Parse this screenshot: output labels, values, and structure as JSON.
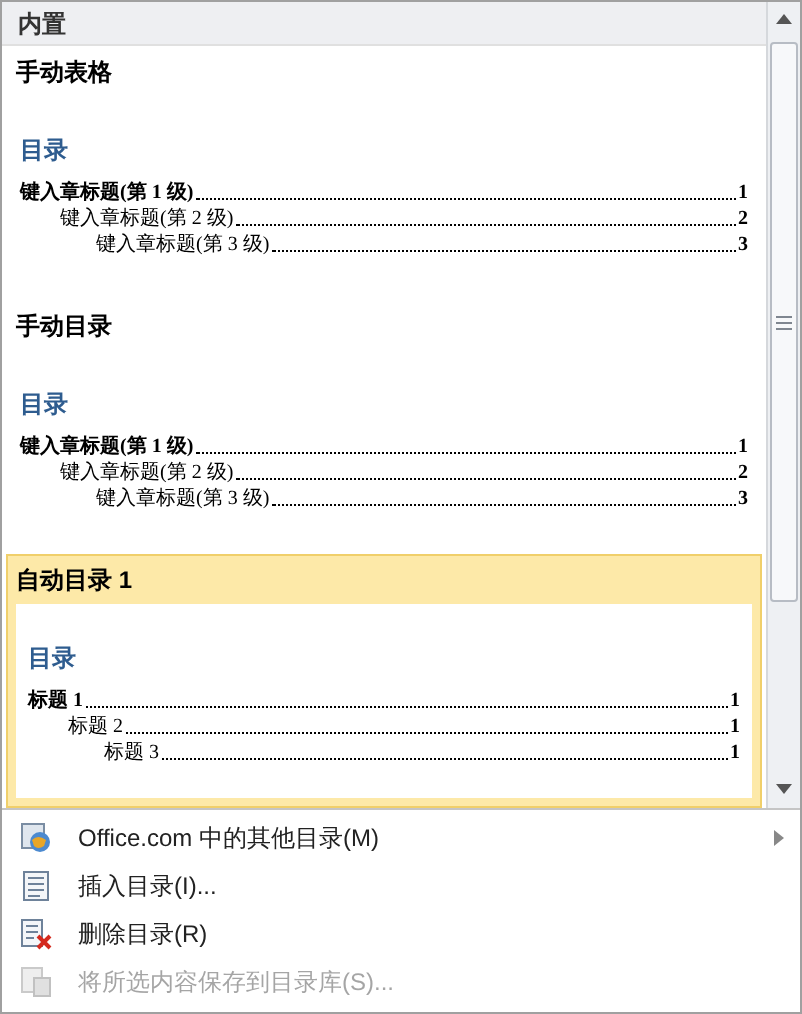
{
  "gallery": {
    "header": "内置",
    "items": [
      {
        "title": "手动表格",
        "selected": false,
        "toc_heading": "目录",
        "entries": [
          {
            "text": "键入章标题(第 1 级)",
            "page": "1",
            "children": [
              {
                "text": "键入章标题(第 2 级)",
                "page": "2",
                "children": [
                  {
                    "text": "键入章标题(第 3 级)",
                    "page": "3"
                  }
                ]
              }
            ]
          }
        ]
      },
      {
        "title": "手动目录",
        "selected": false,
        "toc_heading": "目录",
        "entries": [
          {
            "text": "键入章标题(第 1 级)",
            "page": "1",
            "children": [
              {
                "text": "键入章标题(第 2 级)",
                "page": "2",
                "children": [
                  {
                    "text": "键入章标题(第 3 级)",
                    "page": "3"
                  }
                ]
              }
            ]
          }
        ]
      },
      {
        "title": "自动目录 1",
        "selected": true,
        "toc_heading": "目录",
        "entries": [
          {
            "text": "标题 1",
            "page": "1",
            "children": [
              {
                "text": "标题 2",
                "page": "1",
                "children": [
                  {
                    "text": "标题 3",
                    "page": "1"
                  }
                ]
              }
            ]
          }
        ]
      }
    ]
  },
  "menu": [
    {
      "kind": "web",
      "label": "Office.com 中的其他目录(M)",
      "disabled": false,
      "submenu": true
    },
    {
      "kind": "insert",
      "label": "插入目录(I)...",
      "disabled": false,
      "submenu": false
    },
    {
      "kind": "delete",
      "label": "删除目录(R)",
      "disabled": false,
      "submenu": false
    },
    {
      "kind": "save",
      "label": "将所选内容保存到目录库(S)...",
      "disabled": true,
      "submenu": false
    }
  ]
}
